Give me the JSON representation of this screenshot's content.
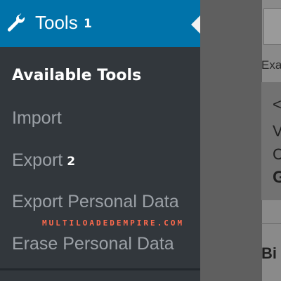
{
  "sidebar": {
    "header": {
      "label": "Tools",
      "badge": "1",
      "icon": "wrench-icon"
    },
    "items": [
      {
        "label": "Available Tools",
        "current": true
      },
      {
        "label": "Import"
      },
      {
        "label": "Export",
        "badge": "2"
      },
      {
        "label": "Export Personal Data"
      },
      {
        "label": "Erase Personal Data"
      }
    ]
  },
  "main": {
    "example_label": "Exa",
    "code_lines": [
      "<",
      "V",
      "C",
      "G"
    ],
    "section_title": "Bi"
  },
  "watermark": "MULTILOADEDEMPIRE.COM",
  "colors": {
    "sidebar_bg": "#32373c",
    "active_bg": "#0073aa",
    "menu_text": "#9ca1a7",
    "watermark": "#ff6a4d"
  }
}
